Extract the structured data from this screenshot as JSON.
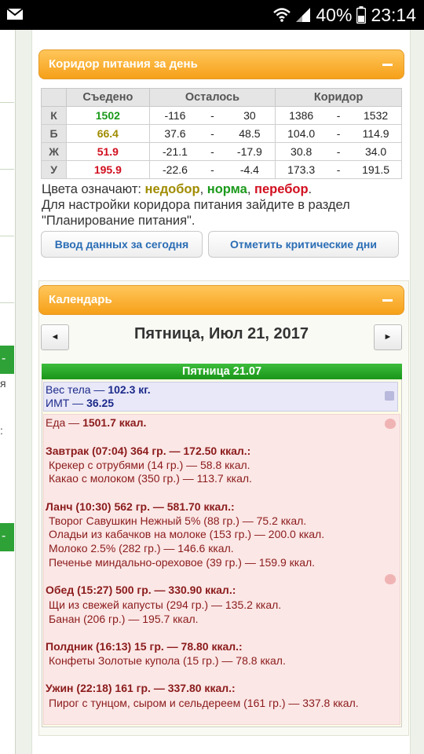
{
  "status": {
    "battery": "40%",
    "time": "23:14"
  },
  "left_fragments": [
    "я",
    ":"
  ],
  "corridor": {
    "title": "Коридор питания за день",
    "headers": [
      "Съедено",
      "Осталось",
      "Коридор"
    ],
    "rows": [
      {
        "letter": "К",
        "eaten": "1502",
        "eaten_color": "#1b9a1b",
        "left_from": "-116",
        "left_to": "30",
        "corr_from": "1386",
        "corr_to": "1532"
      },
      {
        "letter": "Б",
        "eaten": "66.4",
        "eaten_color": "#a08c00",
        "left_from": "37.6",
        "left_to": "48.5",
        "corr_from": "104.0",
        "corr_to": "114.9"
      },
      {
        "letter": "Ж",
        "eaten": "51.9",
        "eaten_color": "#d10f1f",
        "left_from": "-21.1",
        "left_to": "-17.9",
        "corr_from": "30.8",
        "corr_to": "34.0"
      },
      {
        "letter": "У",
        "eaten": "195.9",
        "eaten_color": "#d10f1f",
        "left_from": "-22.6",
        "left_to": "-4.4",
        "corr_from": "173.3",
        "corr_to": "191.5"
      }
    ],
    "dash": "-",
    "legend_prefix": "Цвета означают: ",
    "legend_under": "недобор",
    "legend_sep1": ", ",
    "legend_norm": "норма",
    "legend_sep2": ", ",
    "legend_over": "перебор",
    "legend_end": ".",
    "legend_line2": "Для настройки коридора питания зайдите в раздел",
    "legend_line3": "\"Планирование питания\".",
    "btn_today": "Ввод данных за сегодня",
    "btn_critical": "Отметить критические дни"
  },
  "calendar": {
    "title": "Календарь",
    "prev": "◄",
    "next": "►",
    "date_title": "Пятница, Июл 21, 2017",
    "day_bar": "Пятница 21.07",
    "weight_label": "Вес тела — ",
    "weight_value": "102.3 кг.",
    "bmi_label": "ИМТ — ",
    "bmi_value": "36.25",
    "food_label": "Еда — ",
    "food_total": "1501.7 ккал.",
    "meals": [
      {
        "head": "Завтрак (07:04) 364 гр. — 172.50 ккал.:",
        "items": [
          "Крекер с отрубями (14 гр.) — 58.8 ккал.",
          "Какао с молоком (350 гр.) — 113.7 ккал."
        ]
      },
      {
        "head": "Ланч (10:30) 562 гр. — 581.70 ккал.:",
        "items": [
          "Творог Савушкин Нежный 5% (88 гр.) — 75.2 ккал.",
          "Оладьи из кабачков на молоке (153 гр.) — 200.0 ккал.",
          "Молоко 2.5% (282 гр.) — 146.6 ккал.",
          "Печенье миндально-ореховое (39 гр.) — 159.9 ккал."
        ]
      },
      {
        "head": "Обед (15:27) 500 гр. — 330.90 ккал.:",
        "items": [
          "Щи из свежей капусты (294 гр.) — 135.2 ккал.",
          "Банан (206 гр.) — 195.7 ккал."
        ]
      },
      {
        "head": "Полдник (16:13) 15 гр. — 78.80 ккал.:",
        "items": [
          "Конфеты Золотые купола (15 гр.) — 78.8 ккал."
        ]
      },
      {
        "head": "Ужин (22:18) 161 гр. — 337.80 ккал.:",
        "items": [
          "Пирог с тунцом, сыром и сельдереем (161 гр.) — 337.8 ккал."
        ]
      }
    ]
  }
}
